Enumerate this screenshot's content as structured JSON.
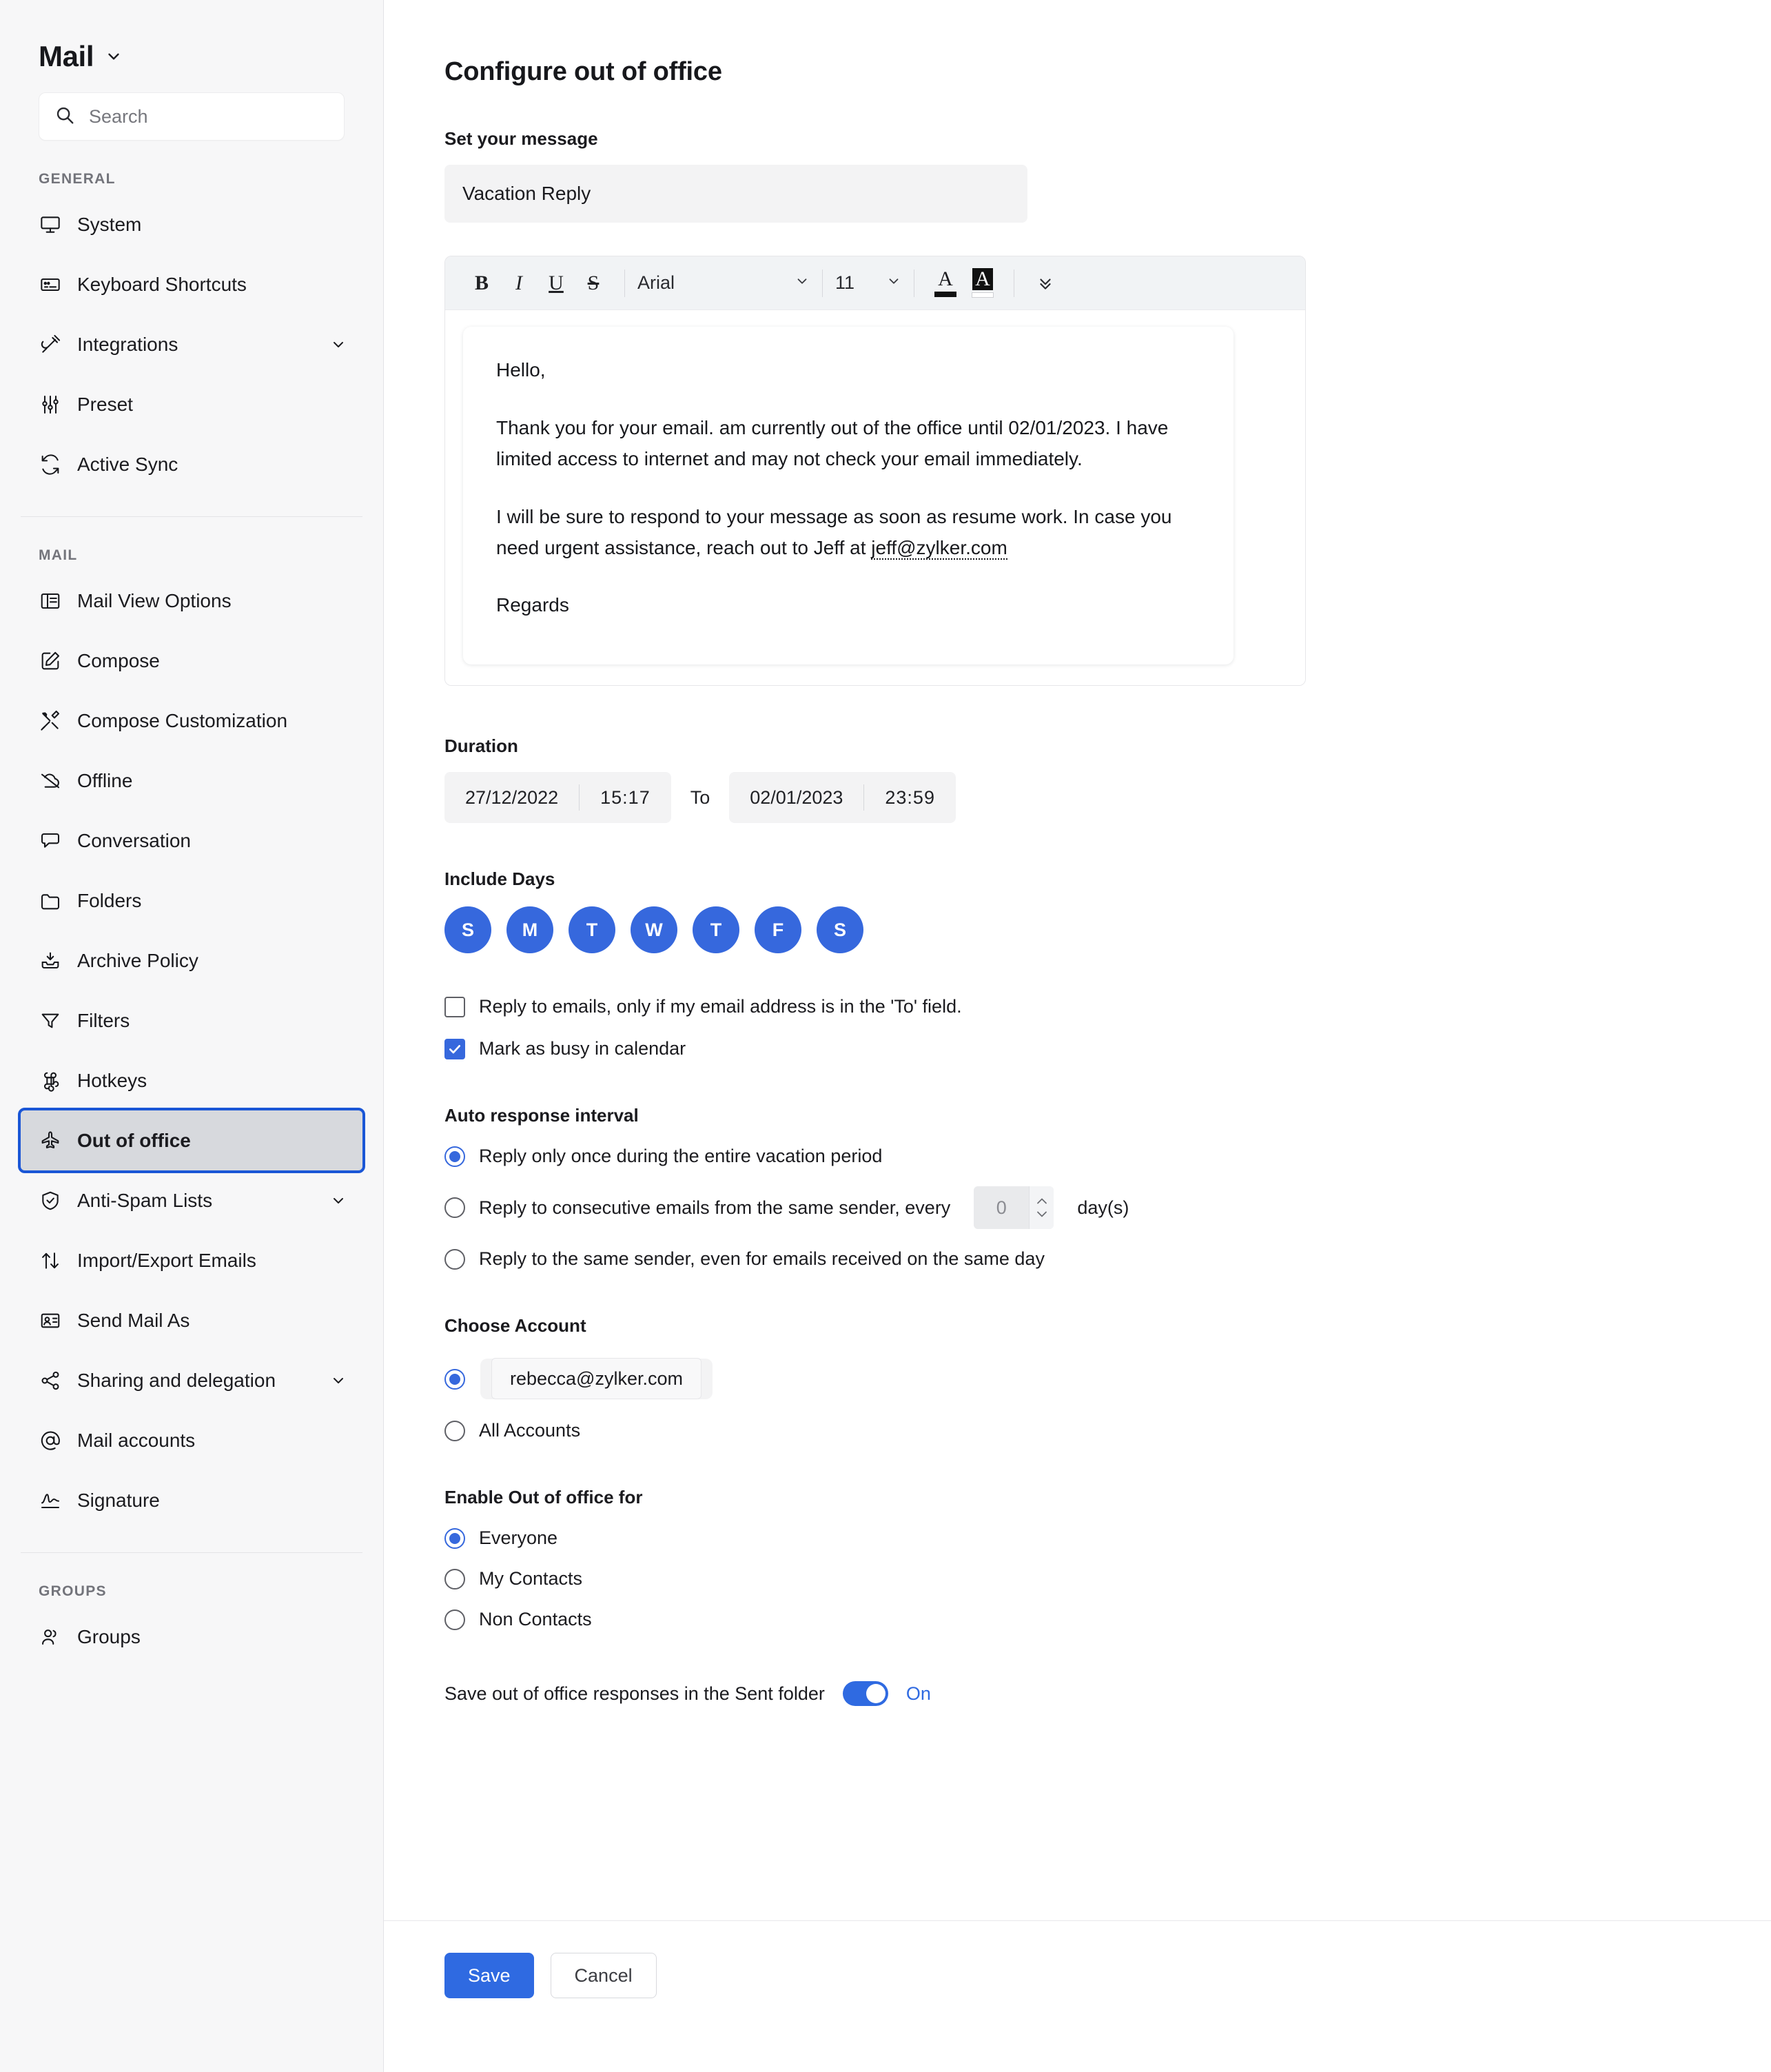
{
  "colors": {
    "accent": "#2f6ae1",
    "day_pill": "#3668dd",
    "active_outline": "#1a56d6",
    "active_bg": "#d7d9dd",
    "sidebar_bg": "#f7f7f8",
    "field_bg": "#f3f3f4"
  },
  "sidebar": {
    "brand": "Mail",
    "search": {
      "placeholder": "Search",
      "value": ""
    },
    "sections": [
      {
        "label": "GENERAL",
        "items": [
          {
            "label": "System",
            "icon": "monitor-icon",
            "caret": false,
            "active": false
          },
          {
            "label": "Keyboard Shortcuts",
            "icon": "keyboard-icon",
            "caret": false,
            "active": false
          },
          {
            "label": "Integrations",
            "icon": "plug-icon",
            "caret": true,
            "active": false
          },
          {
            "label": "Preset",
            "icon": "sliders-icon",
            "caret": false,
            "active": false
          },
          {
            "label": "Active Sync",
            "icon": "sync-icon",
            "caret": false,
            "active": false
          }
        ]
      },
      {
        "label": "MAIL",
        "items": [
          {
            "label": "Mail View Options",
            "icon": "layout-icon",
            "caret": false,
            "active": false
          },
          {
            "label": "Compose",
            "icon": "pencil-square-icon",
            "caret": false,
            "active": false
          },
          {
            "label": "Compose Customization",
            "icon": "tools-icon",
            "caret": false,
            "active": false
          },
          {
            "label": "Offline",
            "icon": "cloud-off-icon",
            "caret": false,
            "active": false
          },
          {
            "label": "Conversation",
            "icon": "chat-icon",
            "caret": false,
            "active": false
          },
          {
            "label": "Folders",
            "icon": "folder-icon",
            "caret": false,
            "active": false
          },
          {
            "label": "Archive Policy",
            "icon": "archive-icon",
            "caret": false,
            "active": false
          },
          {
            "label": "Filters",
            "icon": "funnel-icon",
            "caret": false,
            "active": false
          },
          {
            "label": "Hotkeys",
            "icon": "command-icon",
            "caret": false,
            "active": false
          },
          {
            "label": "Out of office",
            "icon": "airplane-icon",
            "caret": false,
            "active": true
          },
          {
            "label": "Anti-Spam Lists",
            "icon": "shield-check-icon",
            "caret": true,
            "active": false
          },
          {
            "label": "Import/Export Emails",
            "icon": "arrows-up-down-icon",
            "caret": false,
            "active": false
          },
          {
            "label": "Send Mail As",
            "icon": "id-card-icon",
            "caret": false,
            "active": false
          },
          {
            "label": "Sharing and delegation",
            "icon": "share-icon",
            "caret": true,
            "active": false
          },
          {
            "label": "Mail accounts",
            "icon": "at-icon",
            "caret": false,
            "active": false
          },
          {
            "label": "Signature",
            "icon": "signature-icon",
            "caret": false,
            "active": false
          }
        ]
      },
      {
        "label": "GROUPS",
        "items": [
          {
            "label": "Groups",
            "icon": "users-icon",
            "caret": false,
            "active": false
          }
        ]
      }
    ]
  },
  "main": {
    "page_title": "Configure out of office",
    "message": {
      "label": "Set your message",
      "subject_value": "Vacation Reply"
    },
    "toolbar": {
      "bold": "B",
      "italic": "I",
      "underline": "U",
      "strikethrough": "S",
      "font_family": "Arial",
      "font_size": "11",
      "text_color_glyph": "A",
      "highlight_glyph": "A",
      "more_label": "more-options"
    },
    "body": {
      "greeting": "Hello,",
      "paragraph1": "Thank you for your email. am currently out of the office until 02/01/2023. I have limited access to internet and may not check your email immediately.",
      "paragraph2_before": "I will be sure to respond to your message as soon as resume work. In case you need urgent assistance, reach out to Jeff at ",
      "paragraph2_link": "jeff@zylker.com",
      "closing": "Regards"
    },
    "duration": {
      "label": "Duration",
      "from_date": "27/12/2022",
      "from_time": "15:17",
      "to_label": "To",
      "to_date": "02/01/2023",
      "to_time": "23:59"
    },
    "include_days": {
      "label": "Include Days",
      "days": [
        "S",
        "M",
        "T",
        "W",
        "T",
        "F",
        "S"
      ]
    },
    "checkboxes": [
      {
        "label": "Reply to emails, only if my email address is in the 'To' field.",
        "checked": false
      },
      {
        "label": "Mark as busy in calendar",
        "checked": true
      }
    ],
    "auto_response": {
      "label": "Auto response interval",
      "options": [
        {
          "label": "Reply only once during the entire vacation period",
          "selected": true
        },
        {
          "label_before": "Reply to consecutive emails from the same sender, every",
          "label_after": "day(s)",
          "value": "0",
          "selected": false
        },
        {
          "label": "Reply to the same sender, even for emails received on the same day",
          "selected": false
        }
      ]
    },
    "choose_account": {
      "label": "Choose Account",
      "options": [
        {
          "label": "rebecca@zylker.com",
          "selected": true,
          "boxed": true
        },
        {
          "label": "All Accounts",
          "selected": false,
          "boxed": false
        }
      ]
    },
    "enable_for": {
      "label": "Enable Out of office for",
      "options": [
        {
          "label": "Everyone",
          "selected": true
        },
        {
          "label": "My Contacts",
          "selected": false
        },
        {
          "label": "Non Contacts",
          "selected": false
        }
      ]
    },
    "save_sent": {
      "label": "Save out of office responses in the Sent folder",
      "state": "On",
      "on": true
    },
    "footer": {
      "save_label": "Save",
      "cancel_label": "Cancel"
    }
  }
}
